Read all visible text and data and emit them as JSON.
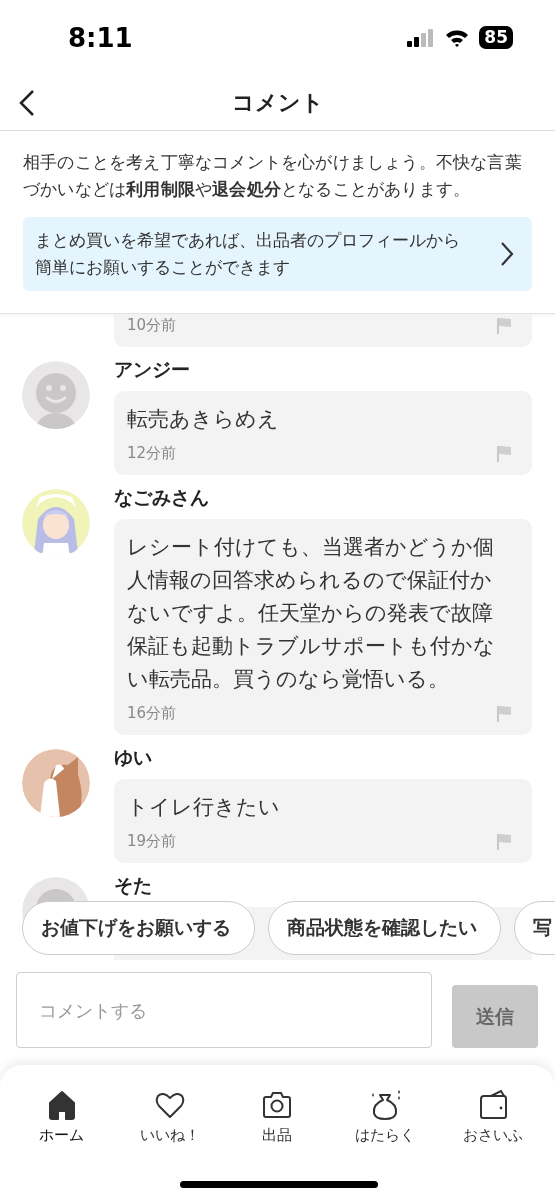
{
  "status_bar": {
    "time": "8:11",
    "battery": "85"
  },
  "header": {
    "title": "コメント"
  },
  "notice": {
    "guideline": "相手のことを考え丁寧なコメントを心がけましょう。不快な言葉づかいなどは**利用制限**や**退会処分**となることがあります。",
    "banner": "まとめ買いを希望であれば、出品者のプロフィールから簡単にお願いすることができます"
  },
  "comments": [
    {
      "time": "10分前"
    },
    {
      "avatar": {
        "kind": "default"
      },
      "name": "アンジー",
      "text": "転売あきらめえ",
      "time": "12分前"
    },
    {
      "avatar": {
        "kind": "doll"
      },
      "name": "なごみさん",
      "text": "レシート付けても、当選者かどうか個人情報の回答求められるので保証付かないですよ。任天堂からの発表で故障保証も起動トラブルサポートも付かない転売品。買うのなら覚悟いる。",
      "time": "16分前"
    },
    {
      "avatar": {
        "kind": "cat"
      },
      "name": "ゆい",
      "text": "トイレ行きたい",
      "time": "19分前"
    },
    {
      "avatar": {
        "kind": "default"
      },
      "name": "そた"
    }
  ],
  "quick_replies": [
    "お値下げをお願いする",
    "商品状態を確認したい",
    "写"
  ],
  "composer": {
    "placeholder": "コメントする",
    "send": "送信",
    "disabled": true
  },
  "tab_bar": [
    {
      "label": "ホーム",
      "selected": true
    },
    {
      "label": "いいね！",
      "selected": false
    },
    {
      "label": "出品",
      "selected": false
    },
    {
      "label": "はたらく",
      "selected": false
    },
    {
      "label": "おさいふ",
      "selected": false
    }
  ]
}
